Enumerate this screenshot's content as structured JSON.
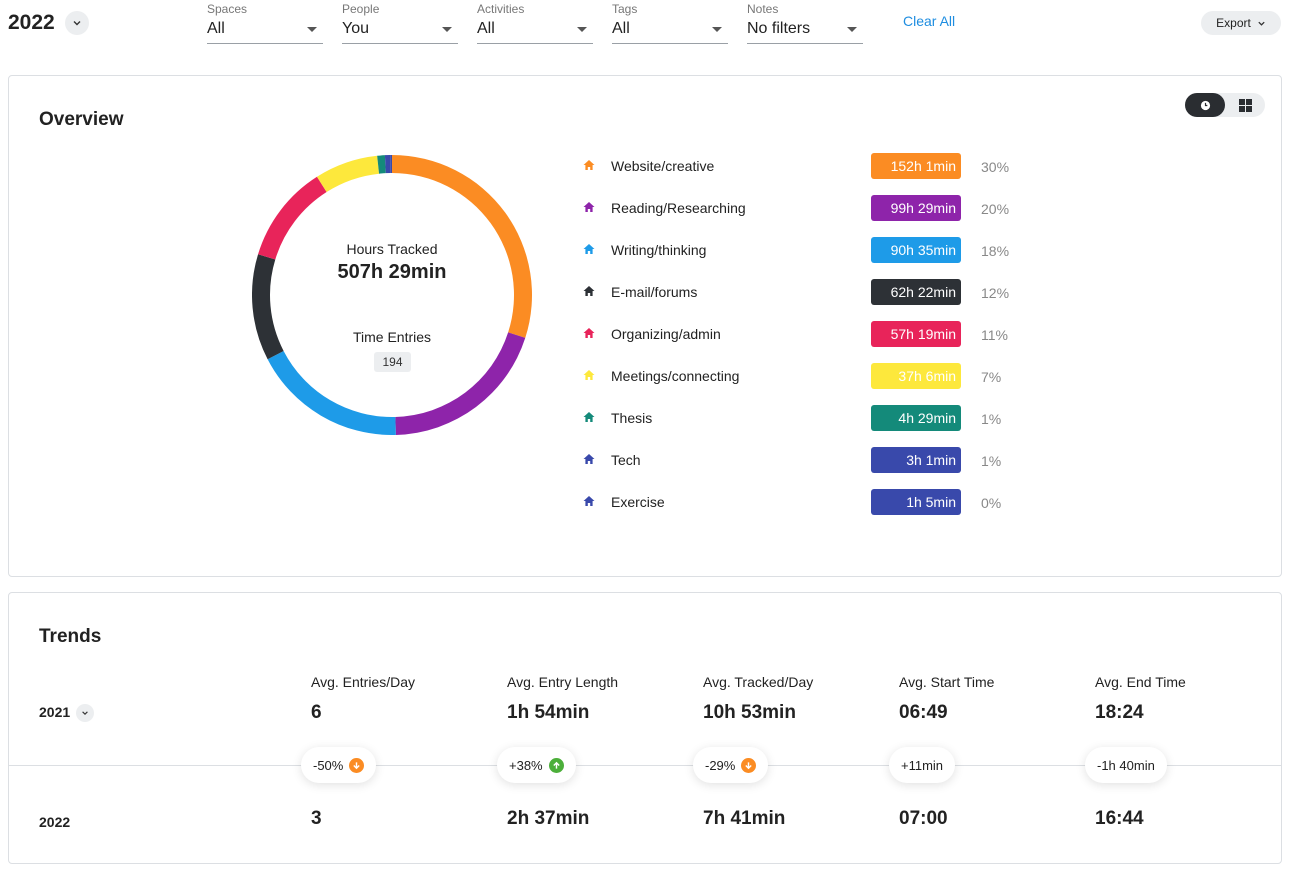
{
  "header": {
    "year": "2022",
    "filters": [
      {
        "label": "Spaces",
        "value": "All"
      },
      {
        "label": "People",
        "value": "You"
      },
      {
        "label": "Activities",
        "value": "All"
      },
      {
        "label": "Tags",
        "value": "All"
      },
      {
        "label": "Notes",
        "value": "No filters"
      }
    ],
    "clear_all": "Clear All",
    "export": "Export"
  },
  "overview": {
    "title": "Overview",
    "hours_label": "Hours Tracked",
    "hours_value": "507h 29min",
    "entries_label": "Time Entries",
    "entries_value": "194",
    "activities": [
      {
        "name": "Website/creative",
        "time": "152h 1min",
        "pct": "30%",
        "color": "#fb8c23",
        "minutes": 9121
      },
      {
        "name": "Reading/Researching",
        "time": "99h 29min",
        "pct": "20%",
        "color": "#8e24aa",
        "minutes": 5969
      },
      {
        "name": "Writing/thinking",
        "time": "90h 35min",
        "pct": "18%",
        "color": "#1e9be8",
        "minutes": 5435
      },
      {
        "name": "E-mail/forums",
        "time": "62h 22min",
        "pct": "12%",
        "color": "#2d3136",
        "minutes": 3742
      },
      {
        "name": "Organizing/admin",
        "time": "57h 19min",
        "pct": "11%",
        "color": "#e8245a",
        "minutes": 3439
      },
      {
        "name": "Meetings/connecting",
        "time": "37h 6min",
        "pct": "7%",
        "color": "#fde83c",
        "minutes": 2226
      },
      {
        "name": "Thesis",
        "time": "4h 29min",
        "pct": "1%",
        "color": "#148a7a",
        "minutes": 269
      },
      {
        "name": "Tech",
        "time": "3h 1min",
        "pct": "1%",
        "color": "#3949ab",
        "minutes": 181
      },
      {
        "name": "Exercise",
        "time": "1h 5min",
        "pct": "0%",
        "color": "#3949ab",
        "minutes": 65
      }
    ]
  },
  "trends": {
    "title": "Trends",
    "year_a": "2021",
    "year_b": "2022",
    "columns": [
      {
        "label": "Avg. Entries/Day",
        "a": "6",
        "b": "3",
        "delta": "-50%",
        "dir": "down"
      },
      {
        "label": "Avg. Entry Length",
        "a": "1h 54min",
        "b": "2h 37min",
        "delta": "+38%",
        "dir": "up"
      },
      {
        "label": "Avg. Tracked/Day",
        "a": "10h 53min",
        "b": "7h 41min",
        "delta": "-29%",
        "dir": "down"
      },
      {
        "label": "Avg. Start Time",
        "a": "06:49",
        "b": "07:00",
        "delta": "+11min",
        "dir": "none"
      },
      {
        "label": "Avg. End Time",
        "a": "18:24",
        "b": "16:44",
        "delta": "-1h 40min",
        "dir": "none"
      }
    ]
  }
}
